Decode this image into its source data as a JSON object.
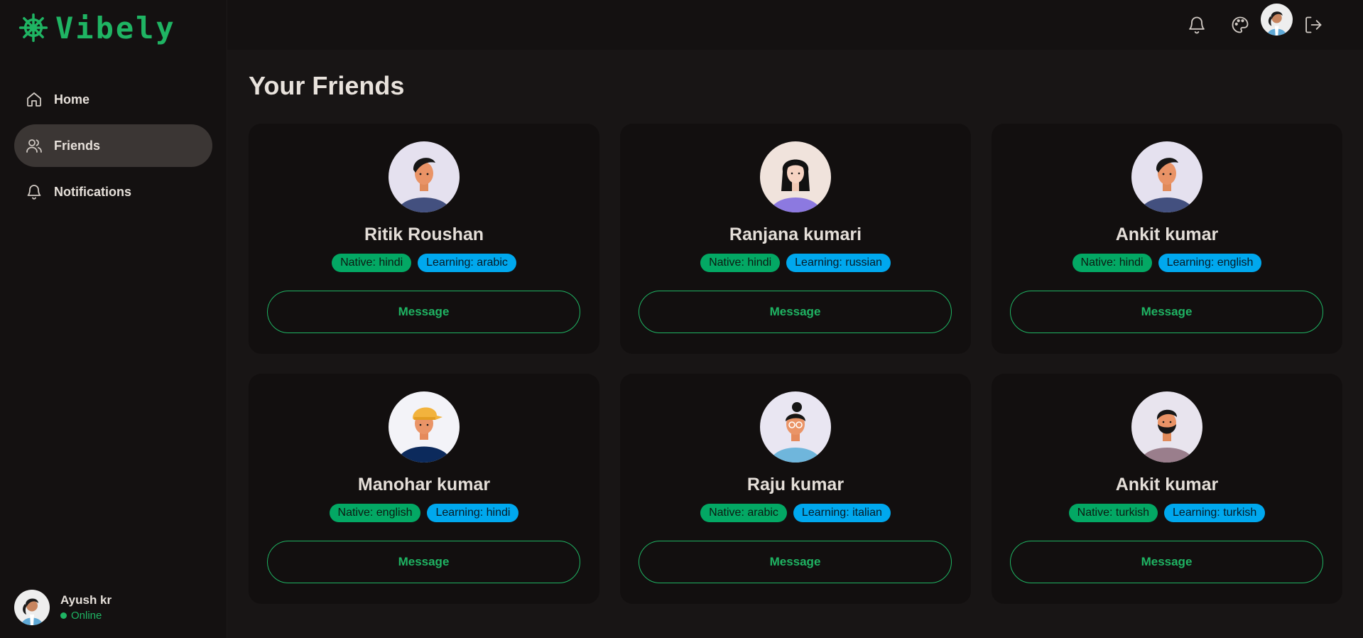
{
  "brand": {
    "name": "Vibely",
    "color": "#1fb463"
  },
  "sidebar": {
    "items": [
      {
        "label": "Home",
        "icon": "home-icon",
        "active": false
      },
      {
        "label": "Friends",
        "icon": "users-icon",
        "active": true
      },
      {
        "label": "Notifications",
        "icon": "bell-icon",
        "active": false
      }
    ]
  },
  "user": {
    "name": "Ayush kr",
    "status": "Online"
  },
  "topbar": {
    "icons": [
      "bell-icon",
      "palette-icon",
      "avatar",
      "logout-icon"
    ]
  },
  "main": {
    "title": "Your Friends",
    "friends": [
      {
        "name": "Ritik Roushan",
        "native": "Native: hindi",
        "learning": "Learning: arabic",
        "button": "Message"
      },
      {
        "name": "Ranjana kumari",
        "native": "Native: hindi",
        "learning": "Learning: russian",
        "button": "Message"
      },
      {
        "name": "Ankit kumar",
        "native": "Native: hindi",
        "learning": "Learning: english",
        "button": "Message"
      },
      {
        "name": "Manohar kumar",
        "native": "Native: english",
        "learning": "Learning: hindi",
        "button": "Message"
      },
      {
        "name": "Raju kumar",
        "native": "Native: arabic",
        "learning": "Learning: italian",
        "button": "Message"
      },
      {
        "name": "Ankit kumar",
        "native": "Native: turkish",
        "learning": "Learning: turkish",
        "button": "Message"
      }
    ]
  },
  "colors": {
    "accent": "#1fb463",
    "native_badge": "#03a864",
    "learning_badge": "#00a8ee",
    "background": "#141111",
    "card": "#120f0f",
    "active_nav": "#3b3634"
  }
}
